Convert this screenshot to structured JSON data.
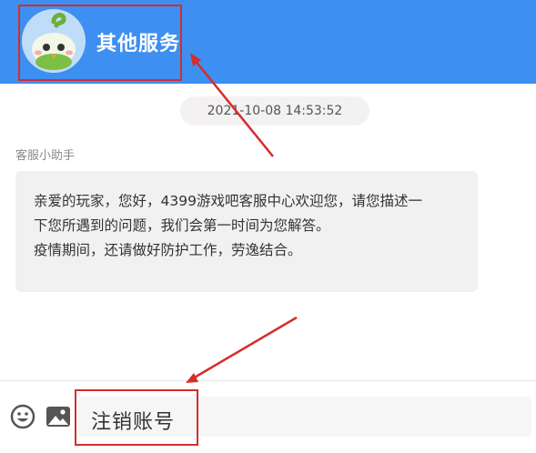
{
  "header": {
    "title": "其他服务",
    "avatar_icon": "green-sprout-mascot-icon",
    "background_color": "#3d8ff1"
  },
  "conversation": {
    "timestamp": "2021-10-08 14:53:52",
    "sender": "客服小助手",
    "message_lines": [
      "亲爱的玩家，您好，4399游戏吧客服中心欢迎您，请您描述一",
      "下您所遇到的问题，我们会第一时间为您解答。",
      "疫情期间，还请做好防护工作，劳逸结合。"
    ]
  },
  "input_bar": {
    "emoji_icon": "emoji-icon",
    "image_icon": "image-icon",
    "value": "注销账号"
  },
  "annotations": {
    "highlight_color": "#d62c2c",
    "arrows": [
      "arrow-to-header",
      "arrow-to-input"
    ]
  }
}
